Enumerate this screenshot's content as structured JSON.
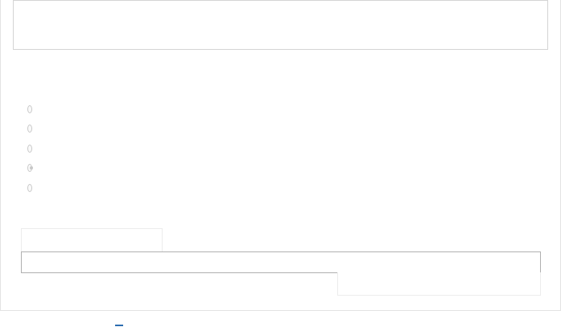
{
  "top_box": {
    "text": ""
  },
  "options": [
    {
      "label": "",
      "checked": false
    },
    {
      "label": "",
      "checked": false
    },
    {
      "label": "",
      "checked": false
    },
    {
      "label": "",
      "checked": true
    },
    {
      "label": "",
      "checked": false
    }
  ],
  "input": {
    "value": "",
    "placeholder": ""
  },
  "tab_left": {
    "label": ""
  },
  "tab_right": {
    "label": ""
  }
}
